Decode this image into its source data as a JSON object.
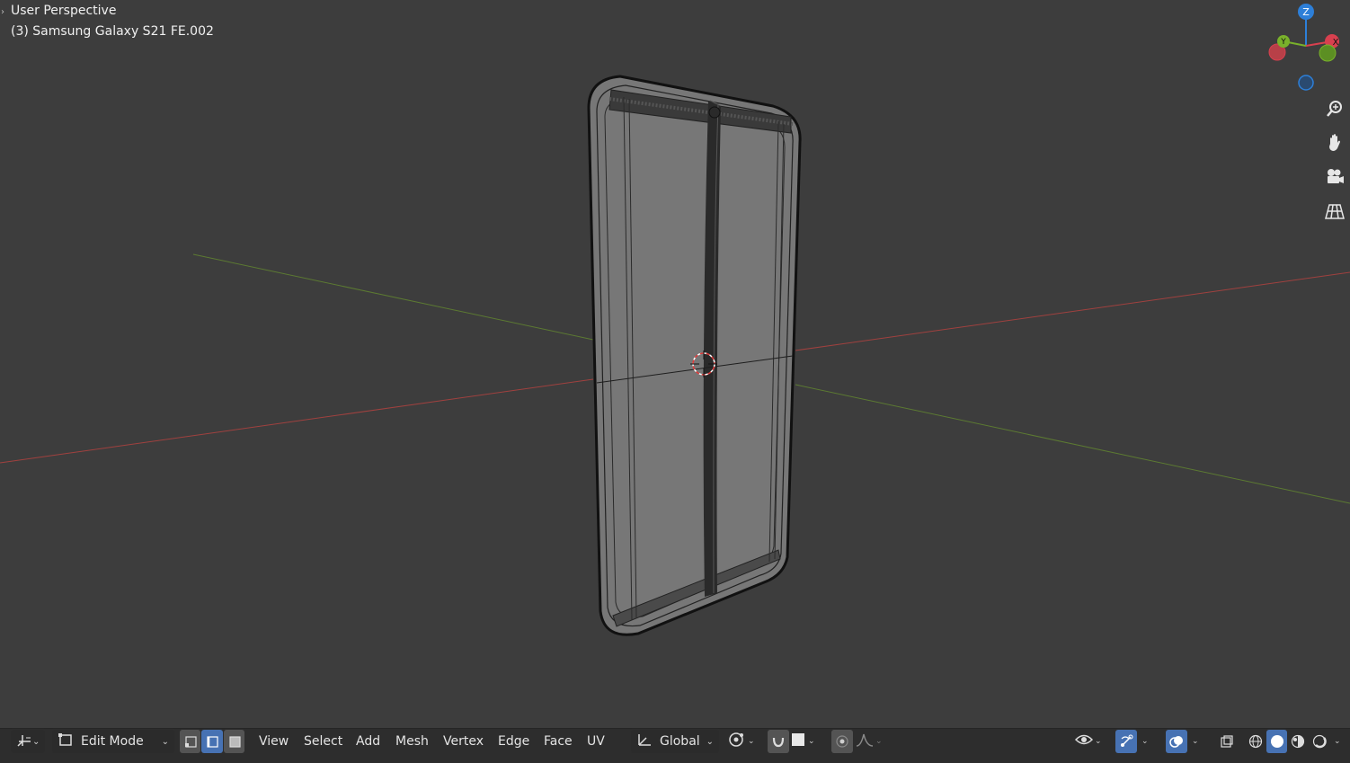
{
  "viewport": {
    "view_name": "User Perspective",
    "object_label": "(3) Samsung Galaxy S21 FE.002"
  },
  "gizmo": {
    "axes": [
      "Z",
      "X",
      "Y"
    ],
    "colors": {
      "x": "#d8404f",
      "y": "#79b12b",
      "z": "#2d7fd8"
    }
  },
  "nav_buttons": [
    {
      "name": "zoom-icon"
    },
    {
      "name": "hand-pan-icon"
    },
    {
      "name": "camera-icon"
    },
    {
      "name": "orthographic-grid-icon"
    }
  ],
  "header": {
    "editor_type_icon": "3d-viewport-icon",
    "mode": "Edit Mode",
    "select_modes": [
      {
        "name": "vertex-select-icon",
        "active": false
      },
      {
        "name": "edge-select-icon",
        "active": true
      },
      {
        "name": "face-select-icon",
        "active": false
      }
    ],
    "menus": [
      "View",
      "Select",
      "Add",
      "Mesh",
      "Vertex",
      "Edge",
      "Face",
      "UV"
    ],
    "transform_orientation": "Global",
    "pivot_icon": "pivot-point-icon",
    "snap_icon": "snap-magnet-icon",
    "snap_target_icon": "snap-target-icon",
    "proportional_icon": "proportional-editing-icon",
    "falloff_icon": "falloff-curve-icon",
    "right_icons": [
      "visibility-eye-icon",
      "gizmo-toggle-icon",
      "overlay-toggle-icon",
      "xray-toggle-icon"
    ],
    "shading_modes": [
      {
        "name": "wireframe-shading-icon",
        "active": false
      },
      {
        "name": "solid-shading-icon",
        "active": true
      },
      {
        "name": "material-shading-icon",
        "active": false
      },
      {
        "name": "rendered-shading-icon",
        "active": false
      }
    ],
    "accent": "#4772b3"
  }
}
